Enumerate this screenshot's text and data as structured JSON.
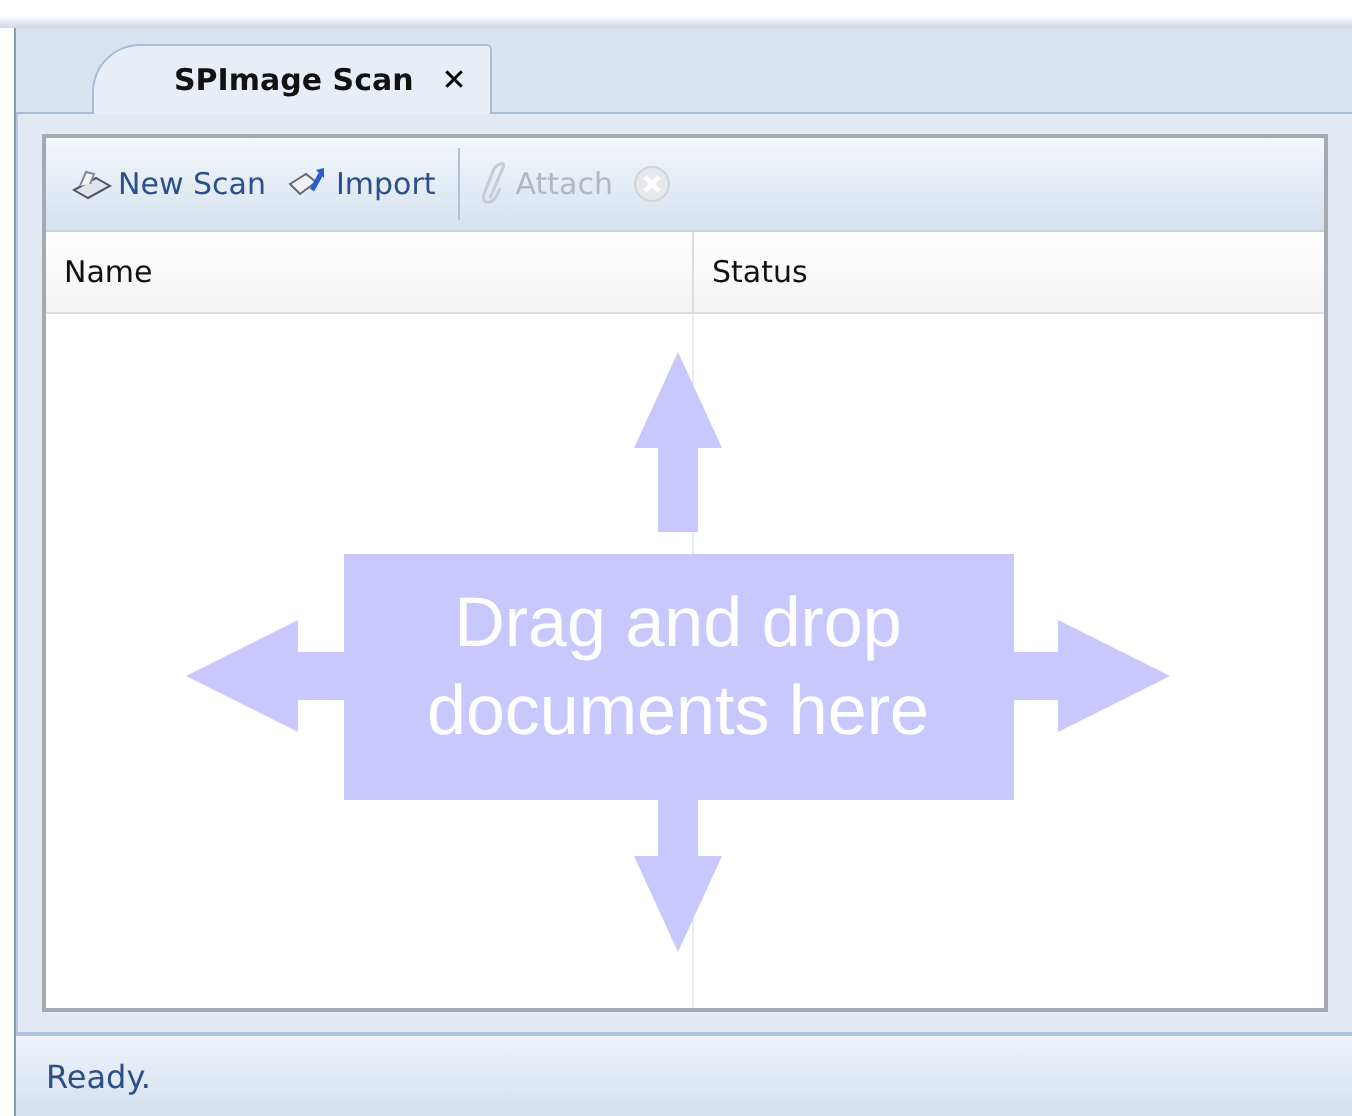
{
  "tabs": [
    {
      "label": "SPImage Scan",
      "close": "✕",
      "selected": true
    }
  ],
  "toolbar": {
    "buttons": [
      {
        "label": "New Scan",
        "disabled": false
      },
      {
        "label": "Import",
        "disabled": false
      },
      {
        "label": "Attach",
        "disabled": true
      }
    ],
    "cancel_button": {
      "disabled": true
    }
  },
  "table": {
    "columns": [
      "Name",
      "Status"
    ]
  },
  "drop_zone": {
    "text": "Drag and drop documents here"
  },
  "status_bar": {
    "text": "Ready."
  }
}
